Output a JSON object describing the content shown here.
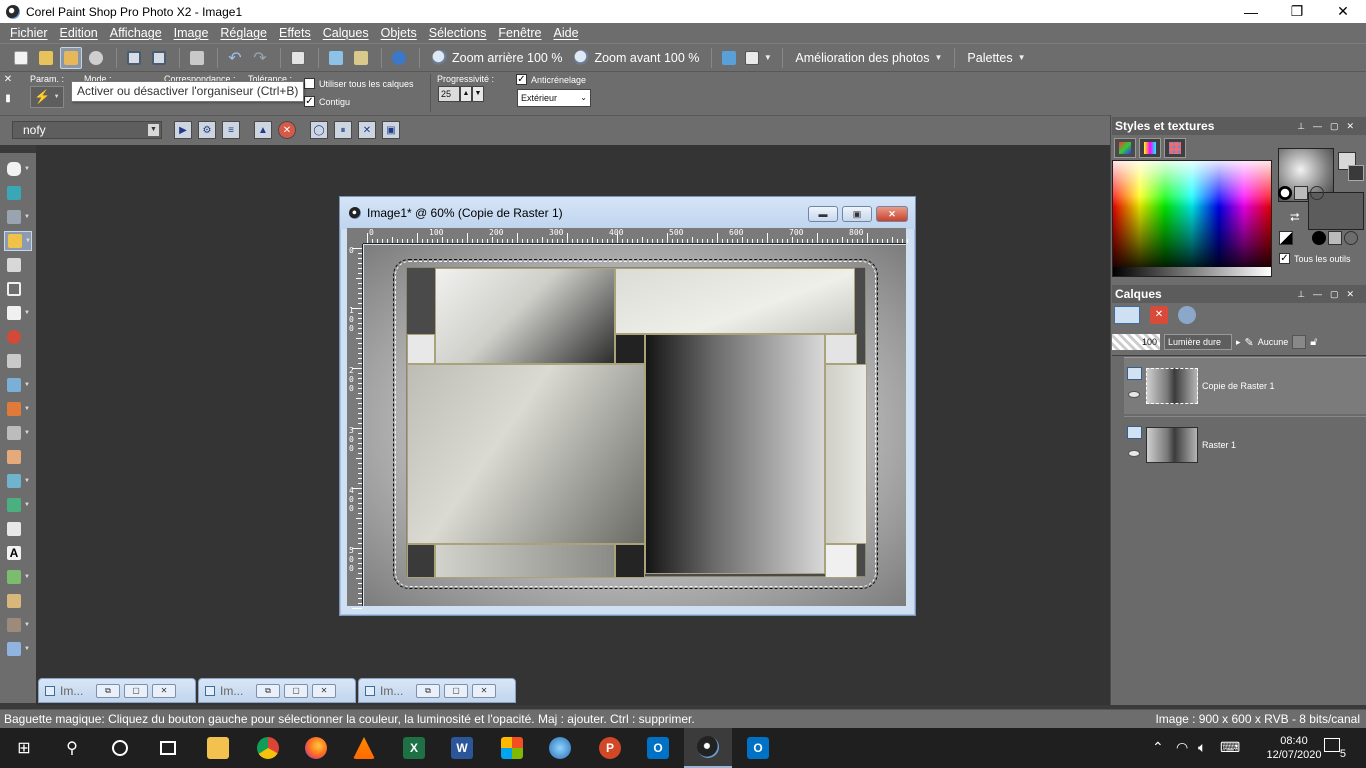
{
  "window": {
    "title": "Corel Paint Shop Pro Photo X2 - Image1",
    "minimize": "—",
    "restore": "❐",
    "close": "✕"
  },
  "menu": [
    "Fichier",
    "Edition",
    "Affichage",
    "Image",
    "Réglage",
    "Effets",
    "Calques",
    "Objets",
    "Sélections",
    "Fenêtre",
    "Aide"
  ],
  "toolbar": {
    "zoom_out": "Zoom arrière 100 %",
    "zoom_in": "Zoom avant 100 %",
    "enhance": "Amélioration des photos",
    "palettes": "Palettes"
  },
  "options": {
    "param": "Param. :",
    "mode": "Mode :",
    "correspondance": "Correspondance :",
    "tolerance": "Tolérance :",
    "all_layers": "Utiliser tous les calques",
    "contiguous": "Contigu",
    "progressivity": "Progressivité :",
    "progressivity_value": "25",
    "antialias": "Anticrénelage",
    "antialias_mode": "Extérieur"
  },
  "tooltip": "Activer ou désactiver l'organiseur (Ctrl+B)",
  "script": {
    "selected": "nofy"
  },
  "image_window": {
    "title": "Image1* @  60% (Copie de Raster 1)",
    "h_ruler": [
      "0",
      "100",
      "200",
      "300",
      "400",
      "500",
      "600",
      "700",
      "800"
    ],
    "v_ruler": [
      "0",
      "1 0 0",
      "2 0 0",
      "3 0 0",
      "4 0 0",
      "5 0 0"
    ]
  },
  "minimized": [
    {
      "label": "Im..."
    },
    {
      "label": "Im..."
    },
    {
      "label": "Im..."
    }
  ],
  "styles_panel": {
    "title": "Styles et textures",
    "all_tools": "Tous les outils"
  },
  "layers_panel": {
    "title": "Calques",
    "opacity": "100",
    "blend_mode": "Lumière dure",
    "mask": "Aucune",
    "layers": [
      {
        "name": "Copie de Raster 1"
      },
      {
        "name": "Raster 1"
      }
    ]
  },
  "status": {
    "hint": "Baguette magique: Cliquez du bouton gauche pour sélectionner la couleur, la luminosité et l'opacité. Maj : ajouter. Ctrl : supprimer.",
    "image_info": "Image :  900 x 600 x RVB - 8 bits/canal"
  },
  "taskbar": {
    "time": "08:40",
    "date": "12/07/2020",
    "notifications": "5"
  },
  "colors": {
    "chrome": "#6d6d6d",
    "workspace": "#343434",
    "window_frame": "#cfe0f3",
    "taskbar": "#1f1f1f"
  }
}
